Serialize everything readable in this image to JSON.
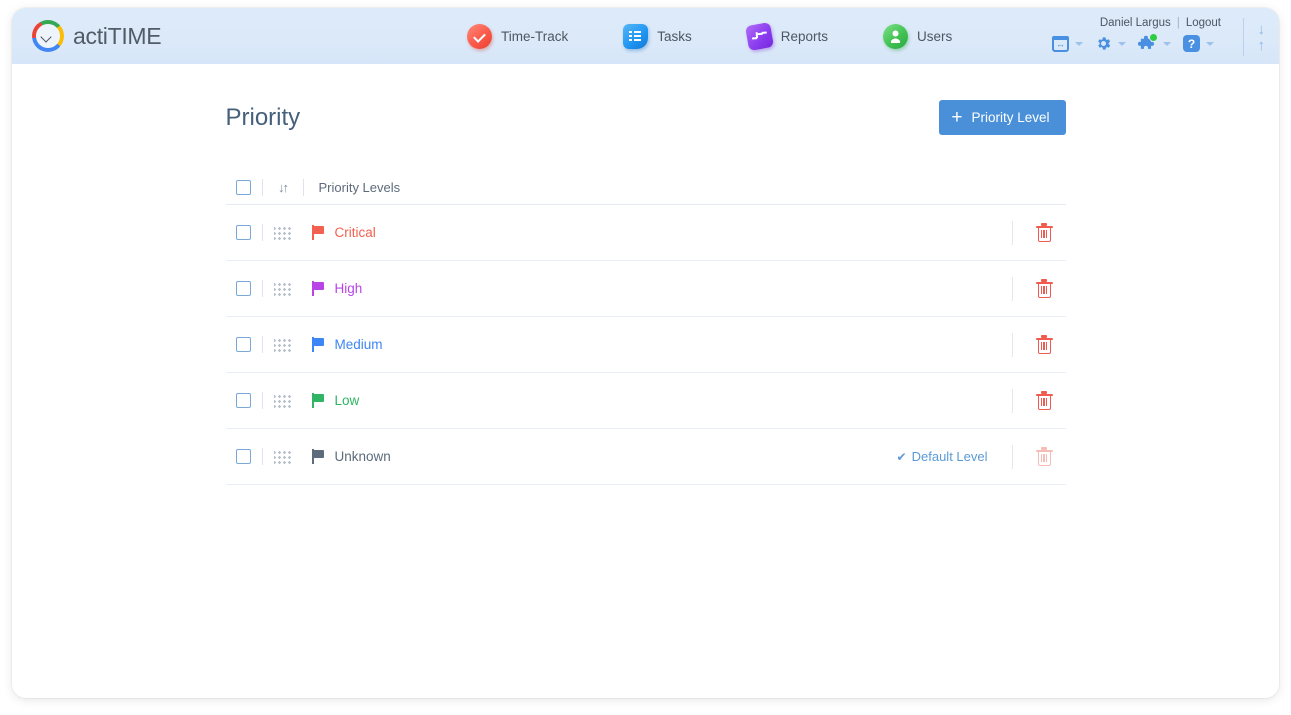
{
  "app": {
    "brand_text": "actiTIME",
    "logo_icon": "acticlock-logo-icon"
  },
  "header": {
    "nav": [
      {
        "label": "Time-Track",
        "icon": "time-track-icon"
      },
      {
        "label": "Tasks",
        "icon": "tasks-icon"
      },
      {
        "label": "Reports",
        "icon": "reports-icon"
      },
      {
        "label": "Users",
        "icon": "users-icon"
      }
    ],
    "user_name": "Daniel Largus",
    "separator": "|",
    "logout_label": "Logout",
    "tool_icons": [
      {
        "name": "calendar-icon",
        "badge": false
      },
      {
        "name": "gear-icon",
        "badge": false
      },
      {
        "name": "puzzle-piece-icon",
        "badge": true
      },
      {
        "name": "help-icon",
        "glyph": "?",
        "badge": false
      }
    ],
    "scroll_down_glyph": "↓",
    "scroll_up_glyph": "↑"
  },
  "main": {
    "title": "Priority",
    "add_button_label": "Priority Level",
    "add_button_plus": "+",
    "add_button_color": "#4a90d9",
    "table": {
      "column_header": "Priority Levels",
      "sort_glyph": "↓↑",
      "rows": [
        {
          "name": "Critical",
          "color": "#f4604f",
          "default": false,
          "deletable": true
        },
        {
          "name": "High",
          "color": "#b844e8",
          "default": false,
          "deletable": true
        },
        {
          "name": "Medium",
          "color": "#3d86f5",
          "default": false,
          "deletable": true
        },
        {
          "name": "Low",
          "color": "#2fb563",
          "default": false,
          "deletable": true
        },
        {
          "name": "Unknown",
          "color": "#5d6b7a",
          "default": true,
          "deletable": false
        }
      ],
      "default_tag_label": "Default Level",
      "default_tag_tick": "✔"
    }
  }
}
